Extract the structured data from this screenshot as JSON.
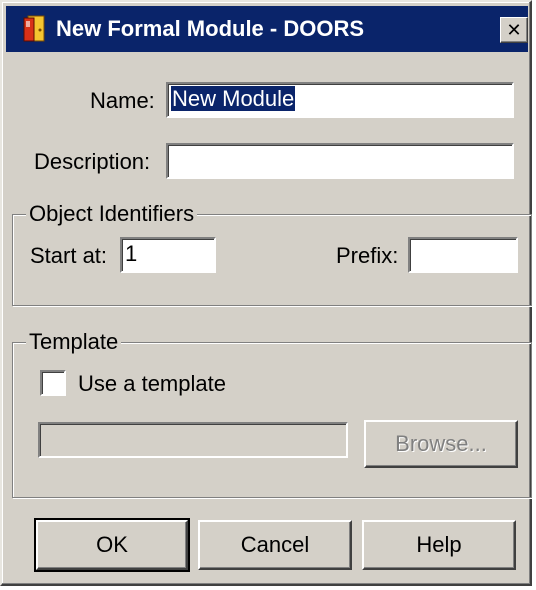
{
  "window": {
    "title": "New Formal Module - DOORS",
    "close_symbol": "✕",
    "app_icon": "doors-app-icon"
  },
  "form": {
    "name_label": "Name:",
    "name_value": "New Module",
    "description_label": "Description:",
    "description_value": ""
  },
  "object_identifiers": {
    "group_title": "Object Identifiers",
    "start_at_label": "Start at:",
    "start_at_value": "1",
    "prefix_label": "Prefix:",
    "prefix_value": ""
  },
  "template": {
    "group_title": "Template",
    "use_template_label": "Use a template",
    "use_template_checked": false,
    "path_value": "",
    "browse_label": "Browse..."
  },
  "buttons": {
    "ok_label": "OK",
    "cancel_label": "Cancel",
    "help_label": "Help"
  },
  "colors": {
    "titlebar": "#0a246a",
    "dialog_face": "#d4d0c8",
    "selection": "#0a246a"
  }
}
